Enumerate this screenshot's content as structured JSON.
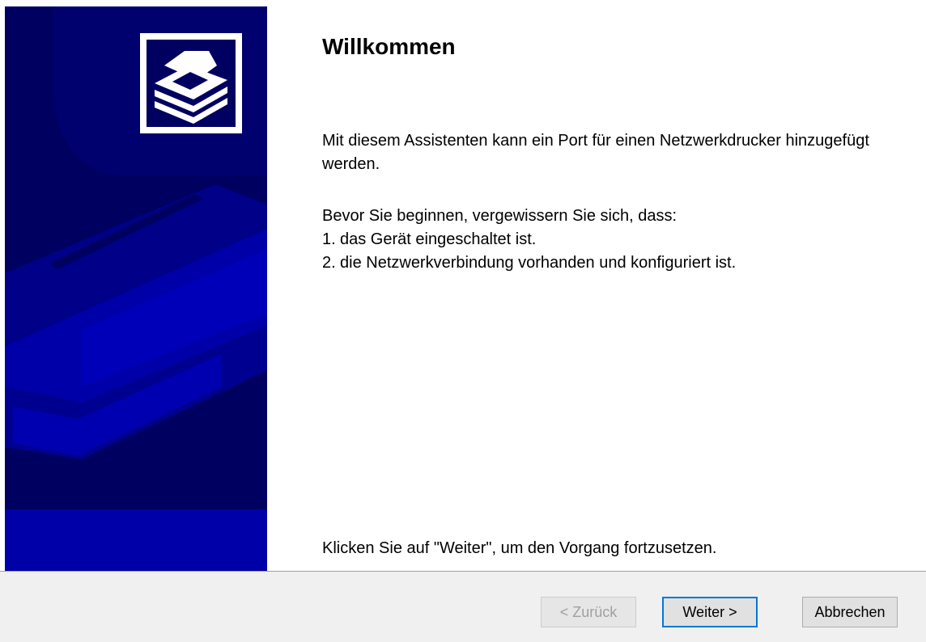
{
  "wizard": {
    "title": "Willkommen",
    "intro": "Mit diesem Assistenten kann ein Port für einen Netzwerkdrucker hinzugefügt werden.",
    "prereq_heading": "Bevor Sie beginnen, vergewissern Sie sich, dass:",
    "prereq_items": [
      {
        "num": "1.",
        "text": "das Gerät eingeschaltet ist."
      },
      {
        "num": "2.",
        "text": "die Netzwerkverbindung vorhanden und konfiguriert ist."
      }
    ],
    "footer": "Klicken Sie auf \"Weiter\", um den Vorgang fortzusetzen."
  },
  "buttons": {
    "back": "< Zurück",
    "next": "Weiter >",
    "cancel": "Abbrechen"
  },
  "banner": {
    "icon": "printer-icon",
    "colors": {
      "dark": "#000060",
      "mid": "#000099",
      "bright": "#0000b8",
      "blue": "#1010c8"
    }
  }
}
